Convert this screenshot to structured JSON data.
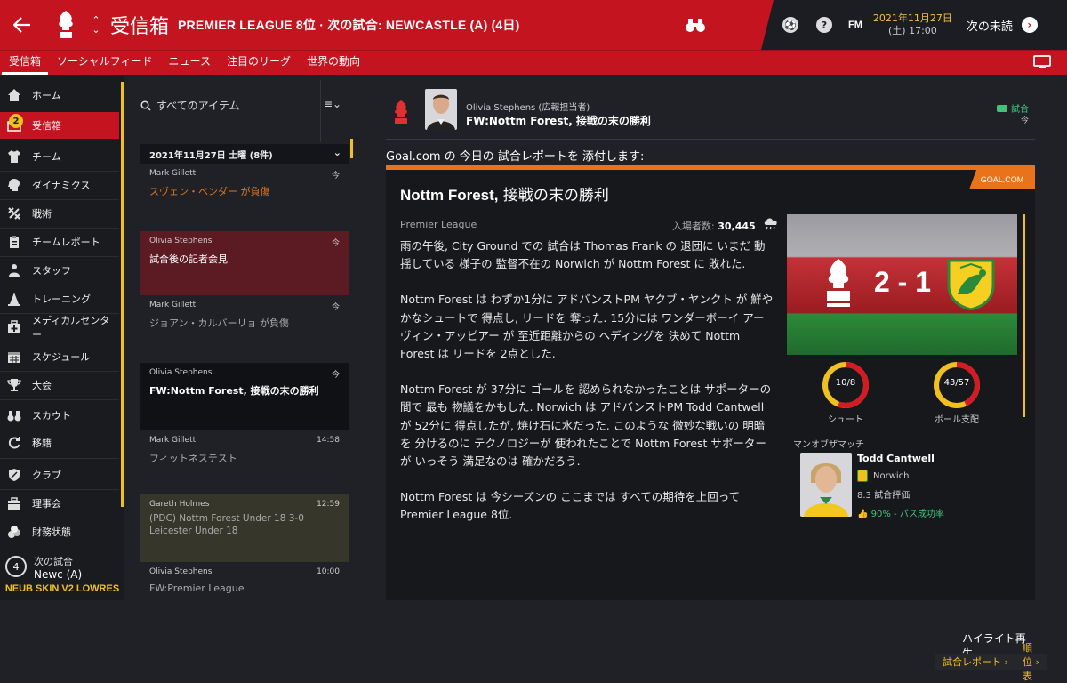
{
  "header": {
    "title": "受信箱",
    "subtitle": "PREMIER LEAGUE 8位 · 次の試合: NEWCASTLE (A) (4日)",
    "fm": "FM",
    "date_line1": "2021年11月27日",
    "date_line2": "(土) 17:00",
    "next_label": "次の未読",
    "help": "?"
  },
  "subnav": {
    "tabs": [
      "受信箱",
      "ソーシャルフィード",
      "ニュース",
      "注目のリーグ",
      "世界の動向"
    ]
  },
  "sidebar": {
    "items": [
      {
        "label": "ホーム",
        "icon": "home-icon"
      },
      {
        "label": "受信箱",
        "icon": "mail-icon",
        "badge": "2"
      },
      {
        "label": "チーム",
        "icon": "shirt-icon"
      },
      {
        "label": "ダイナミクス",
        "icon": "head-icon"
      },
      {
        "label": "戦術",
        "icon": "tactics-icon"
      },
      {
        "label": "チームレポート",
        "icon": "clipboard-icon"
      },
      {
        "label": "スタッフ",
        "icon": "staff-icon"
      },
      {
        "label": "トレーニング",
        "icon": "cone-icon"
      },
      {
        "label": "メディカルセンター",
        "icon": "medical-icon"
      },
      {
        "label": "スケジュール",
        "icon": "calendar-icon"
      },
      {
        "label": "大会",
        "icon": "trophy-icon"
      },
      {
        "label": "スカウト",
        "icon": "binoculars-icon"
      },
      {
        "label": "移籍",
        "icon": "transfer-icon"
      },
      {
        "label": "クラブ",
        "icon": "shield-icon"
      },
      {
        "label": "理事会",
        "icon": "briefcase-icon"
      },
      {
        "label": "財務状態",
        "icon": "coins-icon"
      }
    ],
    "next_match_count": "4",
    "next_match_label": "次の試合",
    "next_match_opponent": "Newc (A)",
    "skin": "NEUB SKIN V2 LOWRES"
  },
  "inbox": {
    "filter_label": "すべてのアイテム",
    "group_label": "2021年11月27日 土曜 (8件)",
    "messages": [
      {
        "from": "Mark Gillett",
        "time": "今",
        "subject": "スヴェン・ベンダー が負傷"
      },
      {
        "from": "Olivia Stephens",
        "time": "今",
        "subject": "試合後の記者会見"
      },
      {
        "from": "Mark Gillett",
        "time": "今",
        "subject": "ジョアン・カルバーリョ が負傷"
      },
      {
        "from": "Olivia Stephens",
        "time": "今",
        "subject": "FW:Nottm Forest, 接戦の末の勝利"
      },
      {
        "from": "Mark Gillett",
        "time": "14:58",
        "subject": "フィットネステスト"
      },
      {
        "from": "Gareth Holmes",
        "time": "12:59",
        "subject": "(PDC) Nottm Forest Under 18 3-0 Leicester Under 18"
      },
      {
        "from": "Olivia Stephens",
        "time": "10:00",
        "subject": "FW:Premier League"
      }
    ]
  },
  "article": {
    "from": "Olivia Stephens (広報担当者)",
    "subject": "FW:Nottm Forest, 接戦の末の勝利",
    "tag": "試合",
    "time": "今",
    "intro": "Goal.com の 今日の 試合レポートを 添付します:",
    "source_badge": "GOAL.COM",
    "headline_team": "Nottm Forest,",
    "headline_rest": " 接戦の末の勝利",
    "competition": "Premier League",
    "attendance_label": "入場者数:",
    "attendance_value": "30,445",
    "paragraphs": [
      "雨の午後, City Ground での 試合は Thomas Frank の 退団に いまだ 動揺している 様子の 監督不在の Norwich が Nottm Forest に 敗れた.",
      "Nottm Forest は わずか1分に アドバンストPM ヤクブ・ヤンクト が 鮮やかなシュートで 得点し, リードを 奪った. 15分には ワンダーボーイ アーヴィン・アッピアー が 至近距離からの ヘディングを 決めて Nottm Forest は リードを 2点とした.",
      "Nottm Forest が 37分に ゴールを 認められなかったことは サポーターの間で 最も 物議をかもした. Norwich は アドバンストPM Todd Cantwell が 52分に 得点したが, 焼け石に水だった. このような 微妙な戦いの 明暗を 分けるのに テクノロジーが 使われたことで Nottm Forest サポーターが いっそう 満足なのは 確かだろう.",
      "Nottm Forest は 今シーズンの ここまでは すべての期待を上回って Premier League 8位."
    ],
    "score": "2 - 1",
    "stats": [
      {
        "value": "10/8",
        "label": "シュート",
        "home": 10,
        "away": 8
      },
      {
        "value": "43/57",
        "label": "ボール支配",
        "home": 43,
        "away": 57
      }
    ],
    "motm_header": "マンオブザマッチ",
    "motm_name": "Todd Cantwell",
    "motm_club": "Norwich",
    "motm_rating": "8.3 試合評価",
    "motm_pass": "90% - パス成功率",
    "highlights": "ハイライト再生",
    "btn_report": "試合レポート",
    "btn_table": "順位表"
  },
  "colors": {
    "accent": "#c4141f",
    "yellow": "#f0c020",
    "orange": "#e8731a",
    "green": "#3fc47a"
  }
}
